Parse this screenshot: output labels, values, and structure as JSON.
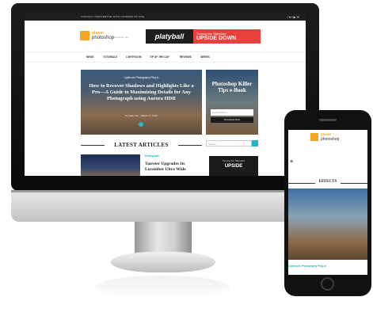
{
  "desktop": {
    "topbar": {
      "links": [
        "CONTACT US",
        "ADVERTISE WITH US",
        "TERMS OF USE"
      ],
      "social": "f  ♥  t  ▶  ✉"
    },
    "logo": {
      "line1": "planet",
      "line2": "photoshop",
      "tagline": "Photoshop Tips"
    },
    "ad": {
      "brand": "platyball",
      "line1": "Turning the Standard",
      "line2": "UPSIDE DOWN"
    },
    "nav": [
      "NEWS",
      "TUTORIALS",
      "LIGHTROOM",
      "TIP OF THE DAY",
      "REVIEWS",
      "SERIES"
    ],
    "hero": {
      "category": "Lightroom  Photography  Plug-in",
      "title": "How to Recover Shadows and Highlights Like a Pro—A Guide to Maximizing Details for Any Photograph using Aurora HDR",
      "meta": "Pu  Sally Sen  ·  March 17, 2019"
    },
    "ebook": {
      "title": "Photoshop Killer Tips e-Book",
      "field_placeholder": "Email Address",
      "button": "Download Now"
    },
    "latest_heading": "LATEST ARTICLES",
    "search_placeholder": "Search ...",
    "post": {
      "category": "Photograph",
      "title": "Tanveer Upgrades Its Lovember Ultra Wide"
    },
    "upside": {
      "line1": "Turning the Standard",
      "line2": "UPSIDE"
    }
  },
  "phone": {
    "logo": {
      "line1": "planet",
      "line2": "photoshop"
    },
    "menu_icon": "≡",
    "section_heading": "EFFECTS",
    "category": "Lightroom  Photography  Plug-in"
  }
}
